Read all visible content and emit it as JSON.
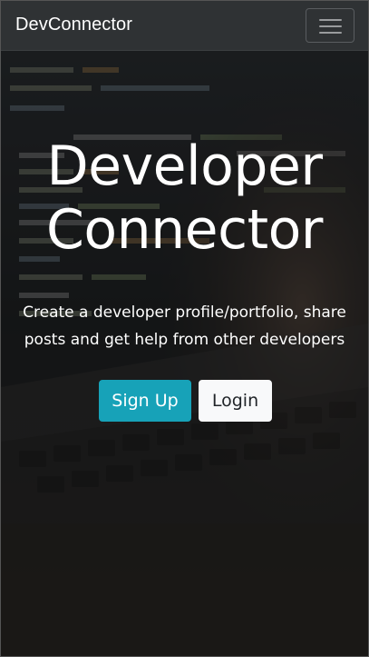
{
  "navbar": {
    "brand": "DevConnector",
    "toggler_icon": "hamburger-menu-icon"
  },
  "hero": {
    "title": "Developer Connector",
    "lead": "Create a developer profile/portfolio, share posts and get help from other developers",
    "background": "laptop-code-photo"
  },
  "actions": {
    "signup_label": "Sign Up",
    "login_label": "Login"
  },
  "colors": {
    "navbar_bg": "#2f3234",
    "signup_bg": "#17a2b8",
    "login_bg": "#f8f9fa",
    "text_light": "#ffffff"
  }
}
